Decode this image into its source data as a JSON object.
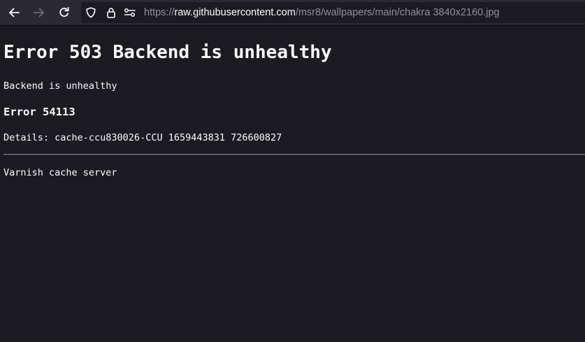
{
  "browser": {
    "back_icon": "arrow-left",
    "forward_icon": "arrow-right",
    "reload_icon": "reload",
    "shield_icon": "tracking-protection-shield",
    "lock_icon": "padlock",
    "permissions_icon": "permissions-sliders",
    "url": {
      "scheme": "https://",
      "host": "raw.githubusercontent.com",
      "path": "/msr8/wallpapers/main/chakra 3840x2160.jpg"
    },
    "colors": {
      "toolbar": "#2b2a33",
      "urlbar": "#1c1b22",
      "icon": "#fbfbfe",
      "icon_disabled": "#6e6d75",
      "url_dim": "#8f8f9d"
    }
  },
  "page": {
    "heading": "Error 503 Backend is unhealthy",
    "message": "Backend is unhealthy",
    "error_code": "Error 54113",
    "details": "Details: cache-ccu830026-CCU 1659443831 726600827",
    "footer": "Varnish cache server",
    "colors": {
      "background": "#1c1b22",
      "text": "#fbfbfe"
    }
  }
}
